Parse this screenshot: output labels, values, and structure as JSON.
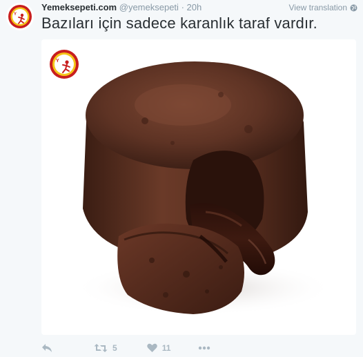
{
  "tweet": {
    "author": {
      "fullname": "Yemeksepeti.com",
      "handle": "@yemeksepeti",
      "avatar_icon": "yemeksepeti-logo"
    },
    "separator": "·",
    "timestamp": "20h",
    "view_translation": "View translation",
    "translate_icon": "globe-icon",
    "text": "Bazıları için sadece karanlık taraf vardır.",
    "media": {
      "watermark_icon": "yemeksepeti-logo",
      "subject": "chocolate-lava-cake-photo"
    },
    "actions": {
      "reply_icon": "reply-icon",
      "retweet_icon": "retweet-icon",
      "retweet_count": "5",
      "like_icon": "heart-icon",
      "like_count": "11",
      "more_icon": "more-icon"
    }
  },
  "colors": {
    "name": "#292f33",
    "secondary": "#8899a6",
    "action": "#aab8c2",
    "background": "#f5f8fa",
    "brand_red": "#c81e1e",
    "brand_yellow": "#f5c518"
  }
}
